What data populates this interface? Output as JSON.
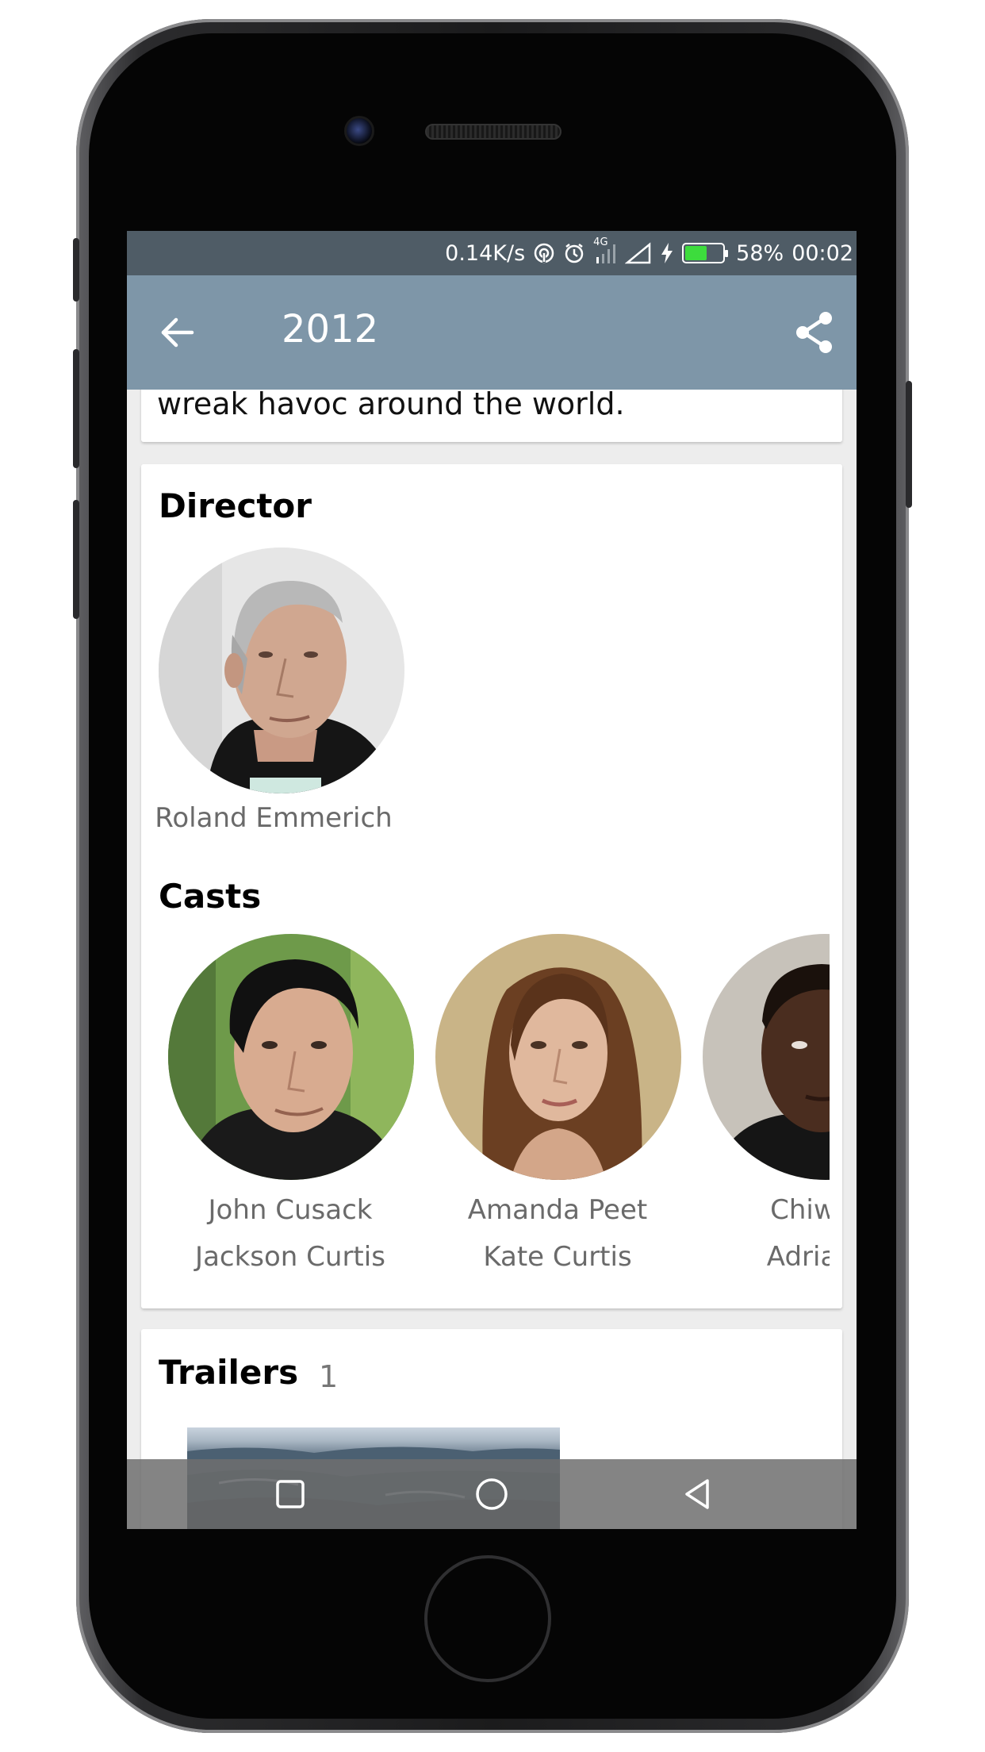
{
  "status_bar": {
    "network_speed": "0.14K/s",
    "network_type": "4G",
    "battery_percent": "58%",
    "battery_level": 0.58,
    "time": "00:02",
    "icons": [
      "hotspot-icon",
      "alarm-icon",
      "signal-icon",
      "charging-icon"
    ]
  },
  "app_bar": {
    "title": "2012",
    "back_icon": "arrow-back-icon",
    "share_icon": "share-icon"
  },
  "overview": {
    "visible_text": "wreak havoc around the world."
  },
  "director_section": {
    "heading": "Director",
    "people": [
      {
        "name": "Roland Emmerich"
      }
    ]
  },
  "cast_section": {
    "heading": "Casts",
    "people": [
      {
        "name": "John Cusack",
        "role": "Jackson Curtis"
      },
      {
        "name": "Amanda Peet",
        "role": "Kate Curtis"
      },
      {
        "name": "Chiwete",
        "role": "Adrian H"
      }
    ]
  },
  "trailers_section": {
    "heading": "Trailers",
    "count": "1"
  },
  "nav_bar": {
    "buttons": [
      "recent-apps-icon",
      "home-icon",
      "back-icon"
    ]
  },
  "colors": {
    "status_bar": "#4f5c66",
    "app_bar": "#7e96a8",
    "battery": "#3ddc3d"
  }
}
